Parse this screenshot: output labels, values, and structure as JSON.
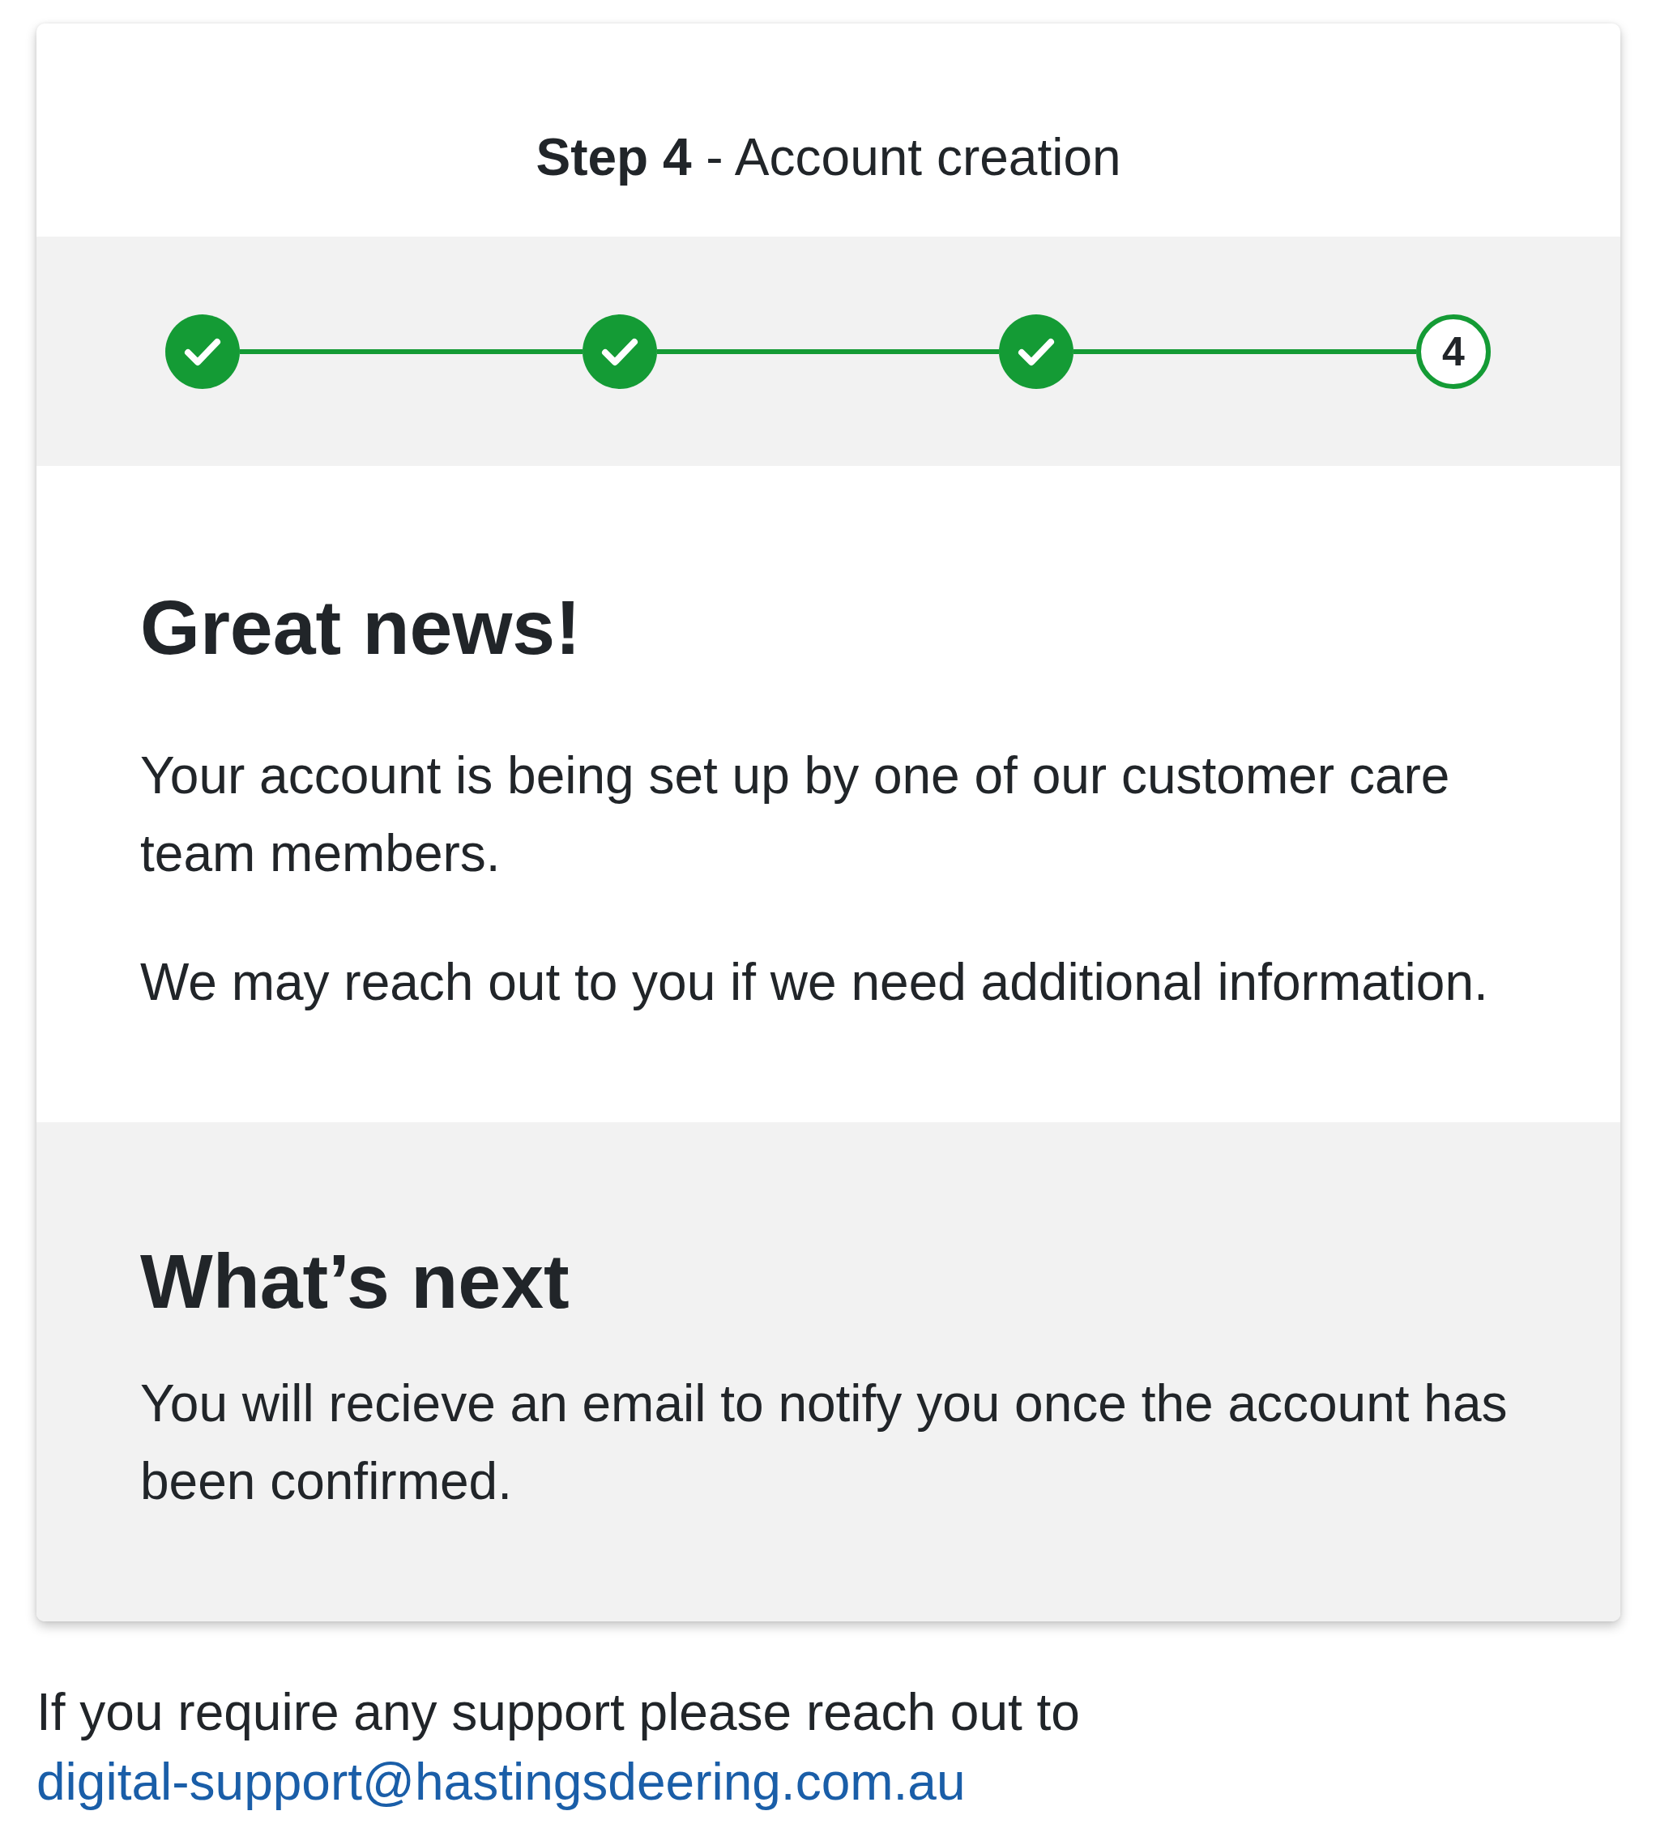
{
  "header": {
    "title": "**Step 4** - Account creation"
  },
  "steps": [
    {
      "completed": true
    },
    {
      "completed": true
    },
    {
      "completed": true
    },
    {
      "completed": false,
      "label": "4"
    }
  ],
  "sections": [
    {
      "kind": "plain",
      "heading": "Great news!",
      "paragraphs": [
        "Your account is being set up by one of our customer care team members.",
        "We may reach out to you if we need additional information."
      ]
    },
    {
      "kind": "shaded",
      "heading": "What’s next",
      "paragraphs": [
        "You will recieve an email to notify you once the account has been confirmed."
      ]
    }
  ],
  "footer": {
    "text": "If you require any support please reach out to",
    "link": "digital-support@hastingsdeering.com.au"
  }
}
